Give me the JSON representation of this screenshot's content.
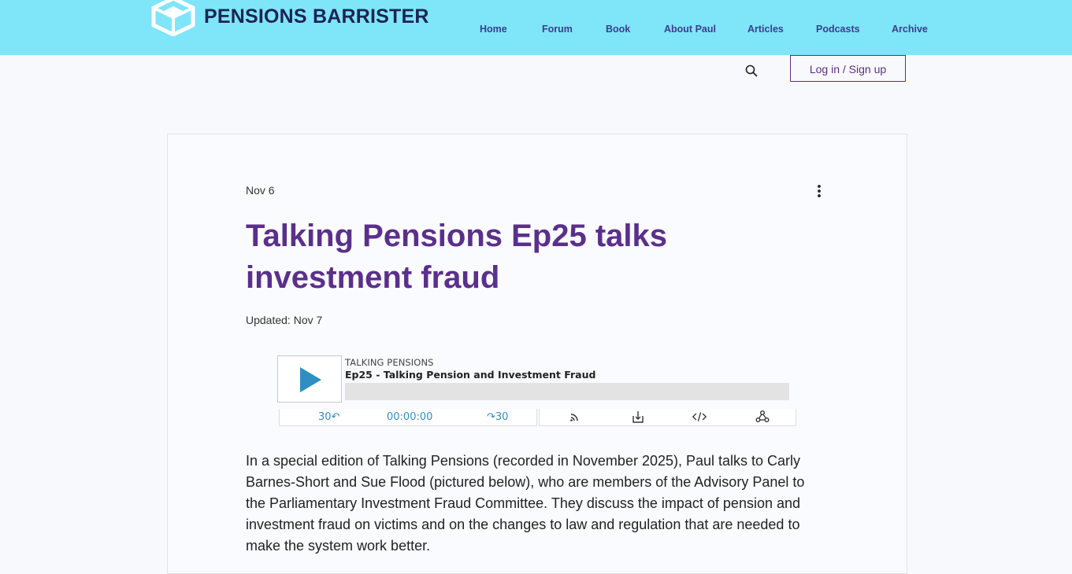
{
  "header": {
    "logo_text": "PENSIONS BARRISTER",
    "nav": [
      {
        "label": "Home"
      },
      {
        "label": "Forum"
      },
      {
        "label": "Book"
      },
      {
        "label": "About Paul"
      },
      {
        "label": "Articles"
      },
      {
        "label": "Podcasts"
      },
      {
        "label": "Archive"
      }
    ],
    "login_label": "Log in / Sign up",
    "search_icon": "search-icon"
  },
  "post": {
    "date": "Nov 6",
    "title": "Talking Pensions Ep25 talks investment fraud",
    "updated": "Updated: Nov 7",
    "body": "In a special edition of Talking Pensions (recorded in November 2025), Paul talks to Carly Barnes-Short and Sue Flood (pictured below), who are members of the Advisory Panel to the Parliamentary Investment Fraud Committee. They discuss the impact of pension and investment fraud on victims and on the changes to law and regulation that are needed to make the system work better."
  },
  "player": {
    "show": "TALKING PENSIONS",
    "episode": "Ep25 - Talking Pension and Investment Fraud",
    "back_label": "30↶",
    "time": "00:00:00",
    "forward_label": "↷30",
    "progress": 0,
    "icons": [
      "rss-icon",
      "download-icon",
      "embed-icon",
      "share-icon"
    ]
  },
  "colors": {
    "header_bg": "#7fe5f8",
    "title": "#5b2f8c",
    "nav": "#3b3e8c",
    "player_accent": "#2f8fc4"
  }
}
